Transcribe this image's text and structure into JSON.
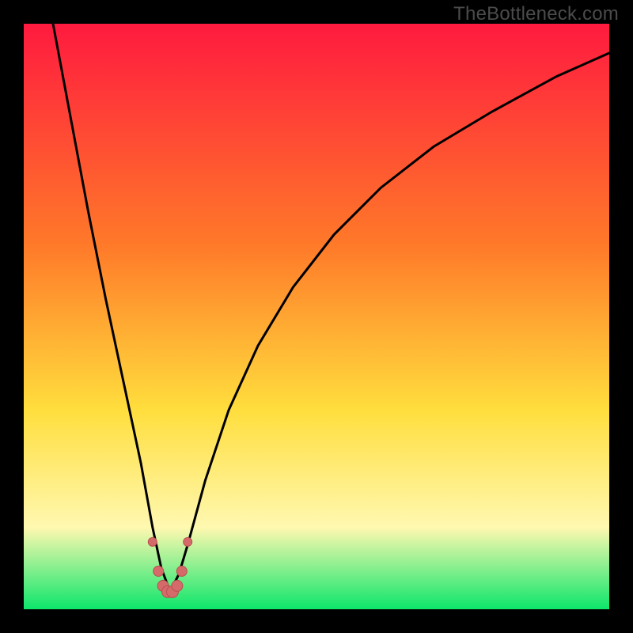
{
  "watermark": "TheBottleneck.com",
  "colors": {
    "gradient_top": "#ff1a3f",
    "gradient_mid1": "#ff7a29",
    "gradient_mid2": "#ffde3d",
    "gradient_mid3": "#fff8b0",
    "gradient_bottom": "#0de66b",
    "curve": "#000000",
    "marker_fill": "#d46a6a",
    "marker_stroke": "#b94f4f",
    "frame": "#000000"
  },
  "chart_data": {
    "type": "line",
    "title": "",
    "xlabel": "",
    "ylabel": "",
    "xlim": [
      0,
      100
    ],
    "ylim": [
      0,
      100
    ],
    "grid": false,
    "legend": false,
    "notch_x": 25,
    "series": [
      {
        "name": "bottleneck-curve",
        "x": [
          5,
          8,
          11,
          14,
          17,
          20,
          22,
          23.5,
          25,
          26.5,
          28,
          31,
          35,
          40,
          46,
          53,
          61,
          70,
          80,
          91,
          100
        ],
        "y": [
          100,
          84,
          68,
          53,
          39,
          25,
          14,
          7,
          3,
          6,
          11,
          22,
          34,
          45,
          55,
          64,
          72,
          79,
          85,
          91,
          95
        ]
      }
    ],
    "markers": {
      "name": "highlight-points",
      "x": [
        22.0,
        23.0,
        23.8,
        24.6,
        25.4,
        26.2,
        27.0,
        28.0
      ],
      "y": [
        11.5,
        6.5,
        4.0,
        3.0,
        3.0,
        4.0,
        6.5,
        11.5
      ],
      "r": [
        5.5,
        6.5,
        7.0,
        7.5,
        7.5,
        7.0,
        6.5,
        5.5
      ]
    }
  }
}
